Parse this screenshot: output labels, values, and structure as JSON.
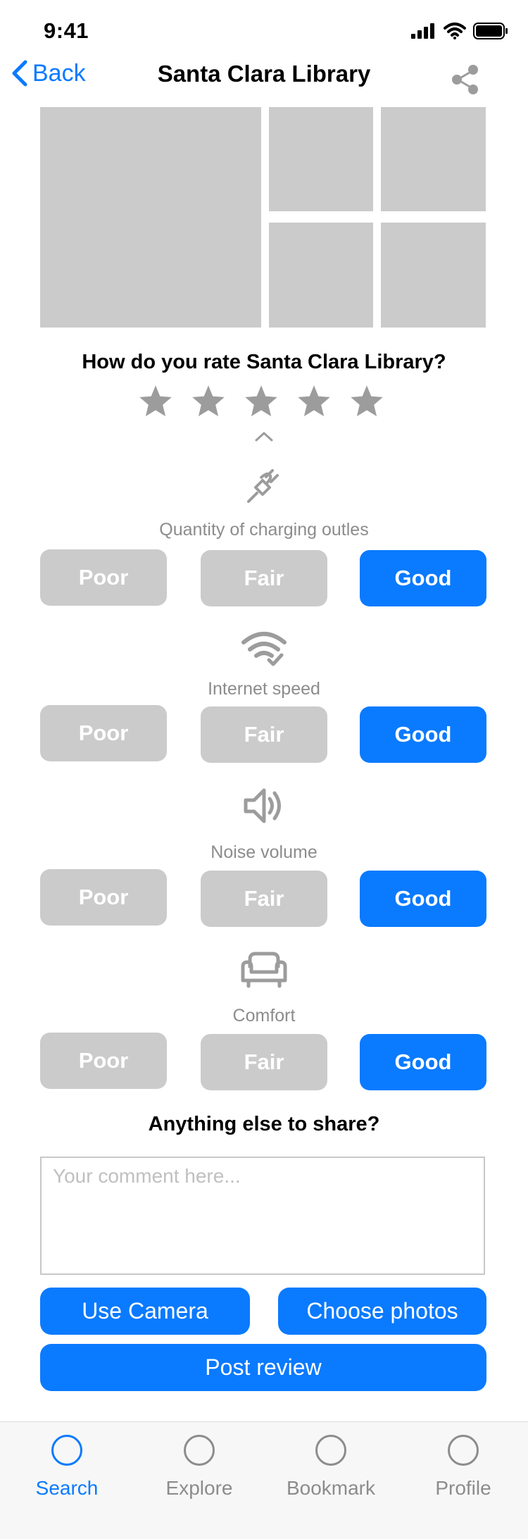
{
  "status_bar": {
    "time": "9:41"
  },
  "nav": {
    "back_label": "Back",
    "title": "Santa Clara Library",
    "share_icon": "share-icon"
  },
  "rating": {
    "question": "How do you rate Santa Clara Library?",
    "stars_total": 5,
    "stars_selected": 0
  },
  "categories": [
    {
      "icon": "plug-icon",
      "label": "Quantity of charging outles",
      "options": [
        "Poor",
        "Fair",
        "Good"
      ],
      "selected": "Good"
    },
    {
      "icon": "wifi-check-icon",
      "label": "Internet speed",
      "options": [
        "Poor",
        "Fair",
        "Good"
      ],
      "selected": "Good"
    },
    {
      "icon": "speaker-icon",
      "label": "Noise volume",
      "options": [
        "Poor",
        "Fair",
        "Good"
      ],
      "selected": "Good"
    },
    {
      "icon": "armchair-icon",
      "label": "Comfort",
      "options": [
        "Poor",
        "Fair",
        "Good"
      ],
      "selected": "Good"
    }
  ],
  "comment": {
    "question": "Anything else to share?",
    "placeholder": "Your comment here...",
    "value": ""
  },
  "actions": {
    "camera_label": "Use Camera",
    "choose_label": "Choose photos",
    "post_label": "Post review"
  },
  "tabbar": {
    "tabs": [
      {
        "label": "Search",
        "active": true
      },
      {
        "label": "Explore",
        "active": false
      },
      {
        "label": "Bookmark",
        "active": false
      },
      {
        "label": "Profile",
        "active": false
      }
    ]
  },
  "colors": {
    "accent": "#0a7aff",
    "inactive_button": "#cbcbcb",
    "placeholder_gray": "#cbcbcb",
    "label_gray": "#8c8c8c"
  }
}
